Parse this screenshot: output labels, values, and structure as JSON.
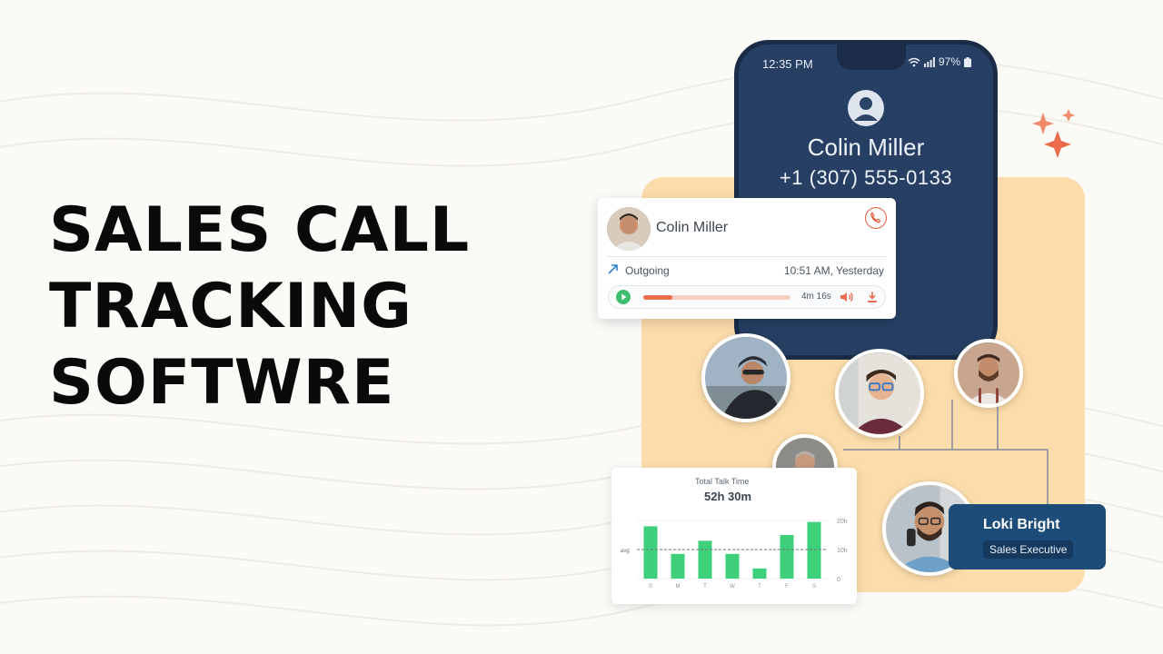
{
  "headline": [
    "SALES CALL",
    "TRACKING",
    "SOFTWRE"
  ],
  "phone": {
    "time": "12:35 PM",
    "battery": "97%",
    "caller_name": "Colin Miller",
    "caller_number": "+1 (307) 555-0133"
  },
  "call_card": {
    "name": "Colin Miller",
    "direction": "Outgoing",
    "timestamp": "10:51 AM, Yesterday",
    "duration": "4m 16s",
    "progress": 0.2
  },
  "chart_data": {
    "type": "bar",
    "title": "Total Talk Time",
    "total": "52h 30m",
    "categories": [
      "S",
      "M",
      "T",
      "W",
      "T",
      "F",
      "S"
    ],
    "values": [
      18,
      8.5,
      13,
      8.5,
      3.5,
      15,
      19.5
    ],
    "ylim": [
      0,
      20
    ],
    "ytick_labels": [
      "0",
      "10h",
      "20h"
    ],
    "avg_label": "avg",
    "avg_value": 10,
    "bar_color": "#3ecf7a"
  },
  "person_card": {
    "name": "Loki Bright",
    "title": "Sales Executive"
  },
  "colors": {
    "accent": "#e8623f",
    "phone_bg": "#263f63",
    "panel": "#fbdcaa",
    "badge": "#1e4c79"
  }
}
